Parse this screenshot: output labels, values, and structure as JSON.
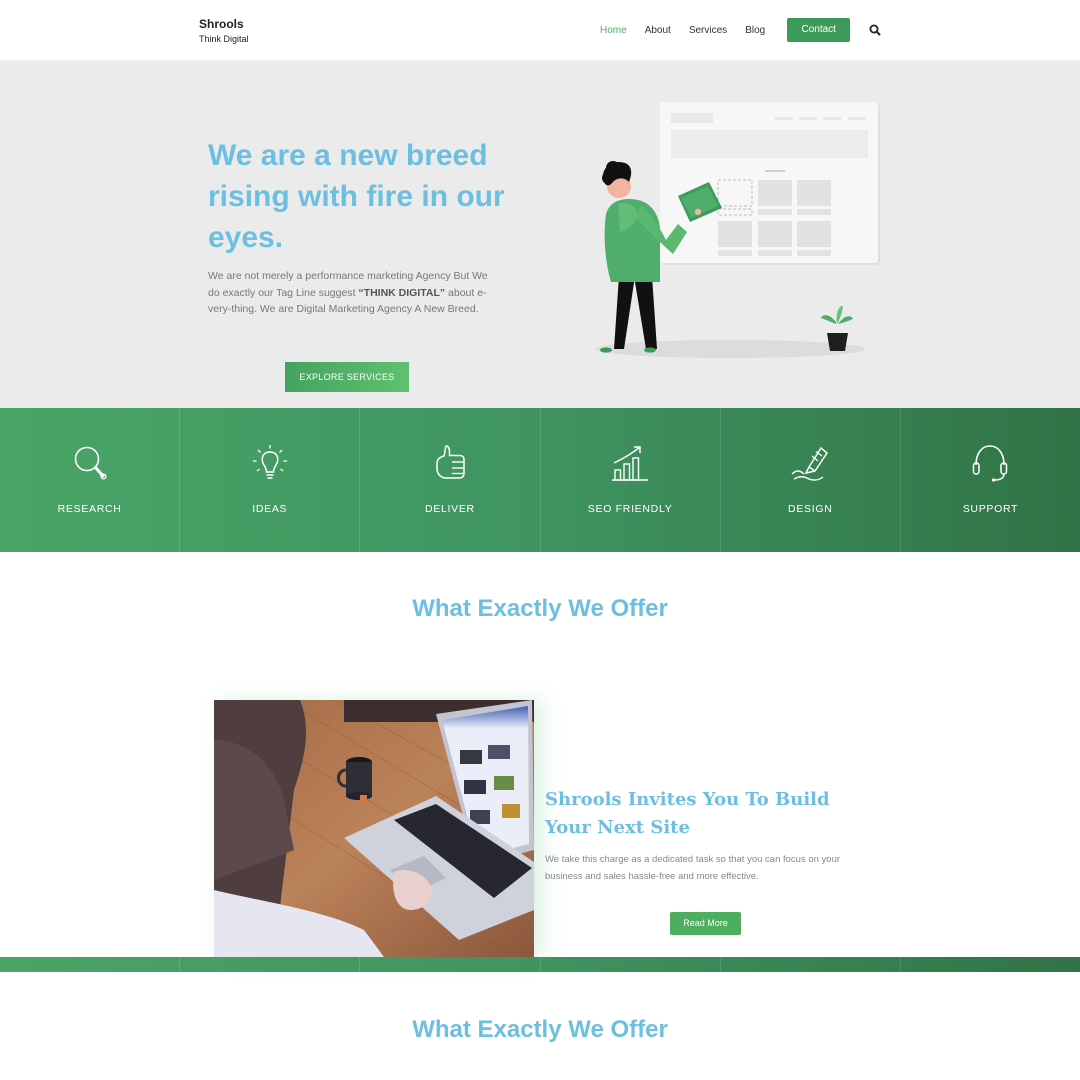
{
  "brand": {
    "name": "Shrools",
    "tagline": "Think Digital"
  },
  "nav": {
    "items": [
      {
        "label": "Home",
        "active": true
      },
      {
        "label": "About"
      },
      {
        "label": "Services"
      },
      {
        "label": "Blog"
      }
    ],
    "contact_label": "Contact",
    "search_icon": "search-icon"
  },
  "hero": {
    "title": "We are a new breed rising with fire in our eyes.",
    "text_1": "We are not merely a  performance marketing Agency But We do exactly our Tag Line suggest ",
    "text_bold": "“THINK DIGITAL”",
    "text_2": " about  e-very-thing. We are Digital Marketing Agency A New Breed.",
    "button_label": "EXPLORE SERVICES"
  },
  "features": [
    {
      "label": "RESEARCH",
      "icon": "magnifier-icon"
    },
    {
      "label": "IDEAS",
      "icon": "lightbulb-icon"
    },
    {
      "label": "DELIVER",
      "icon": "thumbs-up-icon"
    },
    {
      "label": "SEO FRIENDLY",
      "icon": "growth-chart-icon"
    },
    {
      "label": "DESIGN",
      "icon": "pencil-icon"
    },
    {
      "label": "SUPPORT",
      "icon": "headset-icon"
    }
  ],
  "offer": {
    "title": "What Exactly We Offer",
    "card_title": "Shrools Invites You To Build Your Next Site",
    "card_text": "We take this charge as a dedicated task so that you can focus on your business and sales hassle-free and more effective.",
    "card_button": "Read More"
  },
  "offer_repeat_title": "What Exactly We Offer",
  "colors": {
    "accent_green": "#3d9b5a",
    "heading_blue": "#6cbfe0",
    "hero_bg": "#ebebeb"
  }
}
